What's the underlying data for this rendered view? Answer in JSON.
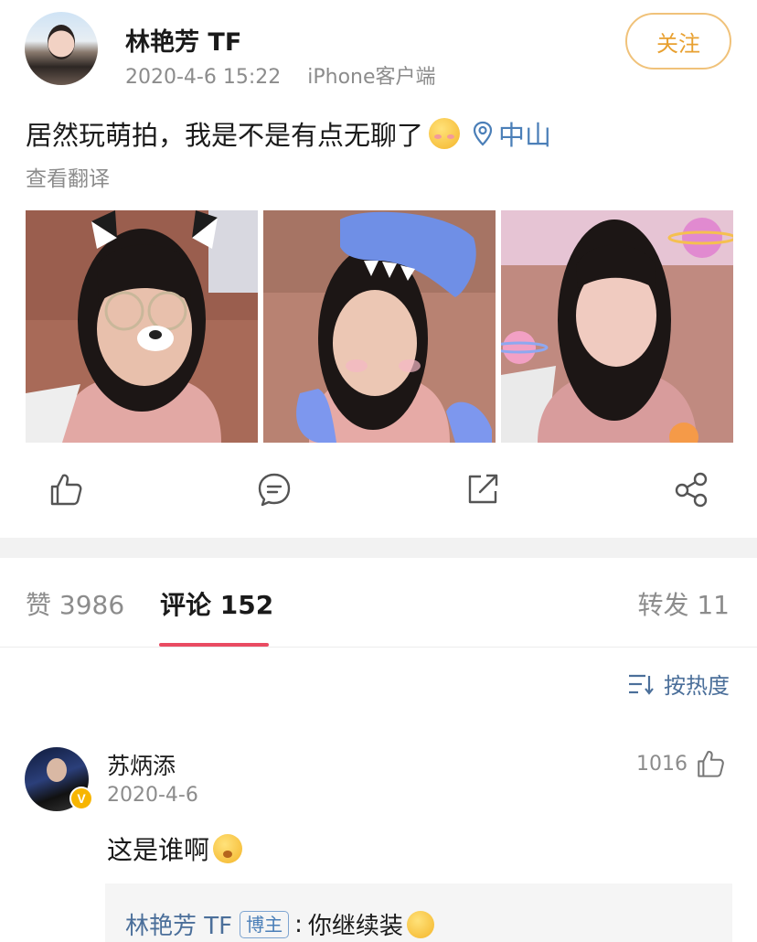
{
  "post": {
    "author": "林艳芳 TF",
    "date": "2020-4-6 15:22",
    "client": "iPhone客户端",
    "follow_label": "关注",
    "text": "居然玩萌拍，我是不是有点无聊了",
    "text_emoji": "smiling-face-with-hearts",
    "location": "中山",
    "translate_label": "查看翻译",
    "photos": [
      "selfie-cat-ears-glasses",
      "selfie-blue-dino-hat",
      "selfie-planet-stickers"
    ],
    "actions": [
      {
        "name": "like",
        "icon": "thumbs-up-icon"
      },
      {
        "name": "comment",
        "icon": "comment-bubble-icon"
      },
      {
        "name": "repost",
        "icon": "repost-icon"
      },
      {
        "name": "share",
        "icon": "share-icon"
      }
    ]
  },
  "tabs": {
    "likes": "赞 3986",
    "comments": "评论 152",
    "reposts": "转发 11",
    "active": "comments",
    "accent_color": "#e94b62"
  },
  "sort": {
    "label": "按热度",
    "icon": "sort-icon"
  },
  "comment": {
    "user": "苏炳添",
    "verified": true,
    "date": "2020-4-6",
    "likes": "1016",
    "text": "这是谁啊",
    "text_emoji": "flushed-face",
    "reply": {
      "author": "林艳芳 TF",
      "badge": "博主",
      "separator": ":",
      "text": "你继续装",
      "emoji": "shushing-face"
    }
  },
  "colors": {
    "link_blue": "#4b6f9a",
    "follow_orange": "#e8a030",
    "verified_gold": "#f7b500"
  }
}
